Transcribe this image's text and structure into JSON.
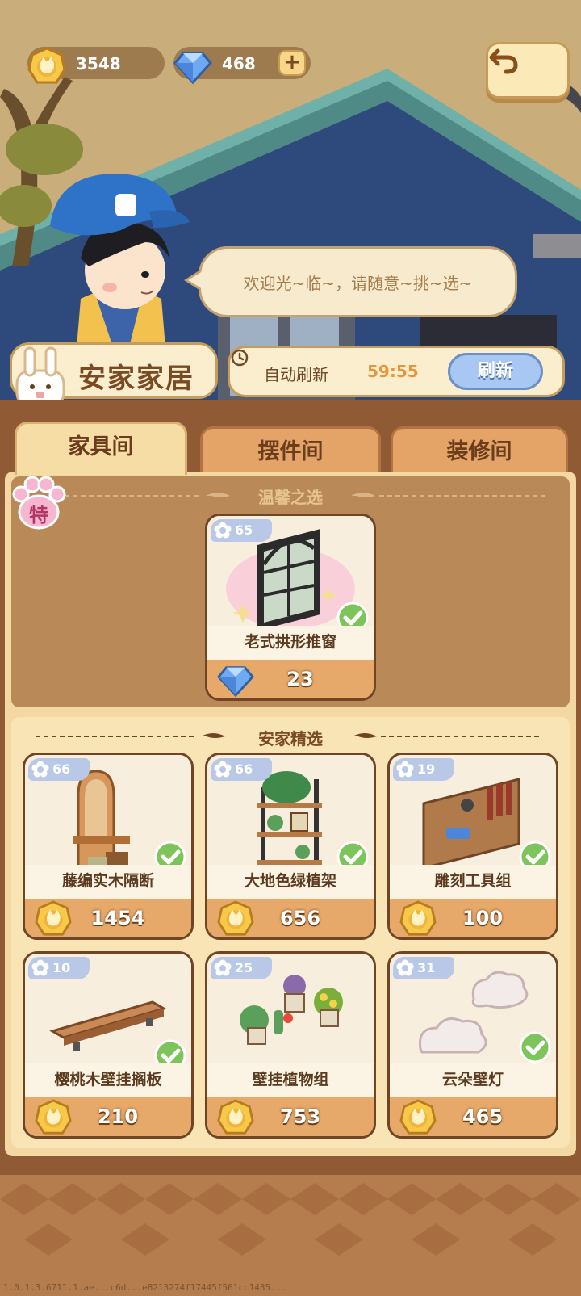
{
  "currency": {
    "gold": "3548",
    "gems": "468",
    "plus_label": "+"
  },
  "npc": {
    "greeting": "欢迎光~临~，请随意~挑~选~"
  },
  "shop": {
    "name": "安家家居",
    "refresh_label": "自动刷新",
    "refresh_timer": "59:55",
    "refresh_button": "刷新"
  },
  "tabs": [
    {
      "label": "家具间",
      "active": true
    },
    {
      "label": "摆件间",
      "active": false
    },
    {
      "label": "装修间",
      "active": false
    }
  ],
  "special_badge": "特",
  "featured_section": {
    "title": "温馨之选",
    "item": {
      "level": "65",
      "name": "老式拱形推窗",
      "price": "23",
      "currency": "gem",
      "owned": true
    }
  },
  "selection_section": {
    "title": "安家精选",
    "items": [
      {
        "level": "66",
        "name": "藤编实木隔断",
        "price": "1454",
        "currency": "gold",
        "owned": true
      },
      {
        "level": "66",
        "name": "大地色绿植架",
        "price": "656",
        "currency": "gold",
        "owned": true
      },
      {
        "level": "19",
        "name": "雕刻工具组",
        "price": "100",
        "currency": "gold",
        "owned": true
      },
      {
        "level": "10",
        "name": "樱桃木壁挂搁板",
        "price": "210",
        "currency": "gold",
        "owned": true
      },
      {
        "level": "25",
        "name": "壁挂植物组",
        "price": "753",
        "currency": "gold",
        "owned": false
      },
      {
        "level": "31",
        "name": "云朵壁灯",
        "price": "465",
        "currency": "gold",
        "owned": true
      }
    ]
  },
  "icons": {
    "gold": "gold-coin-icon",
    "gem": "diamond-icon",
    "back": "back-arrow-icon",
    "check": "check-icon",
    "level": "flower-icon",
    "clock": "clock-icon"
  },
  "colors": {
    "accent_orange": "#e7953a",
    "refresh_blue": "#a8c8f3",
    "check_green": "#7dc45a",
    "panel_brown": "#8f5a34"
  },
  "version_text": "1.0.1.3.6711.1.ae...c6d...e8213274f17445f561cc1435..."
}
